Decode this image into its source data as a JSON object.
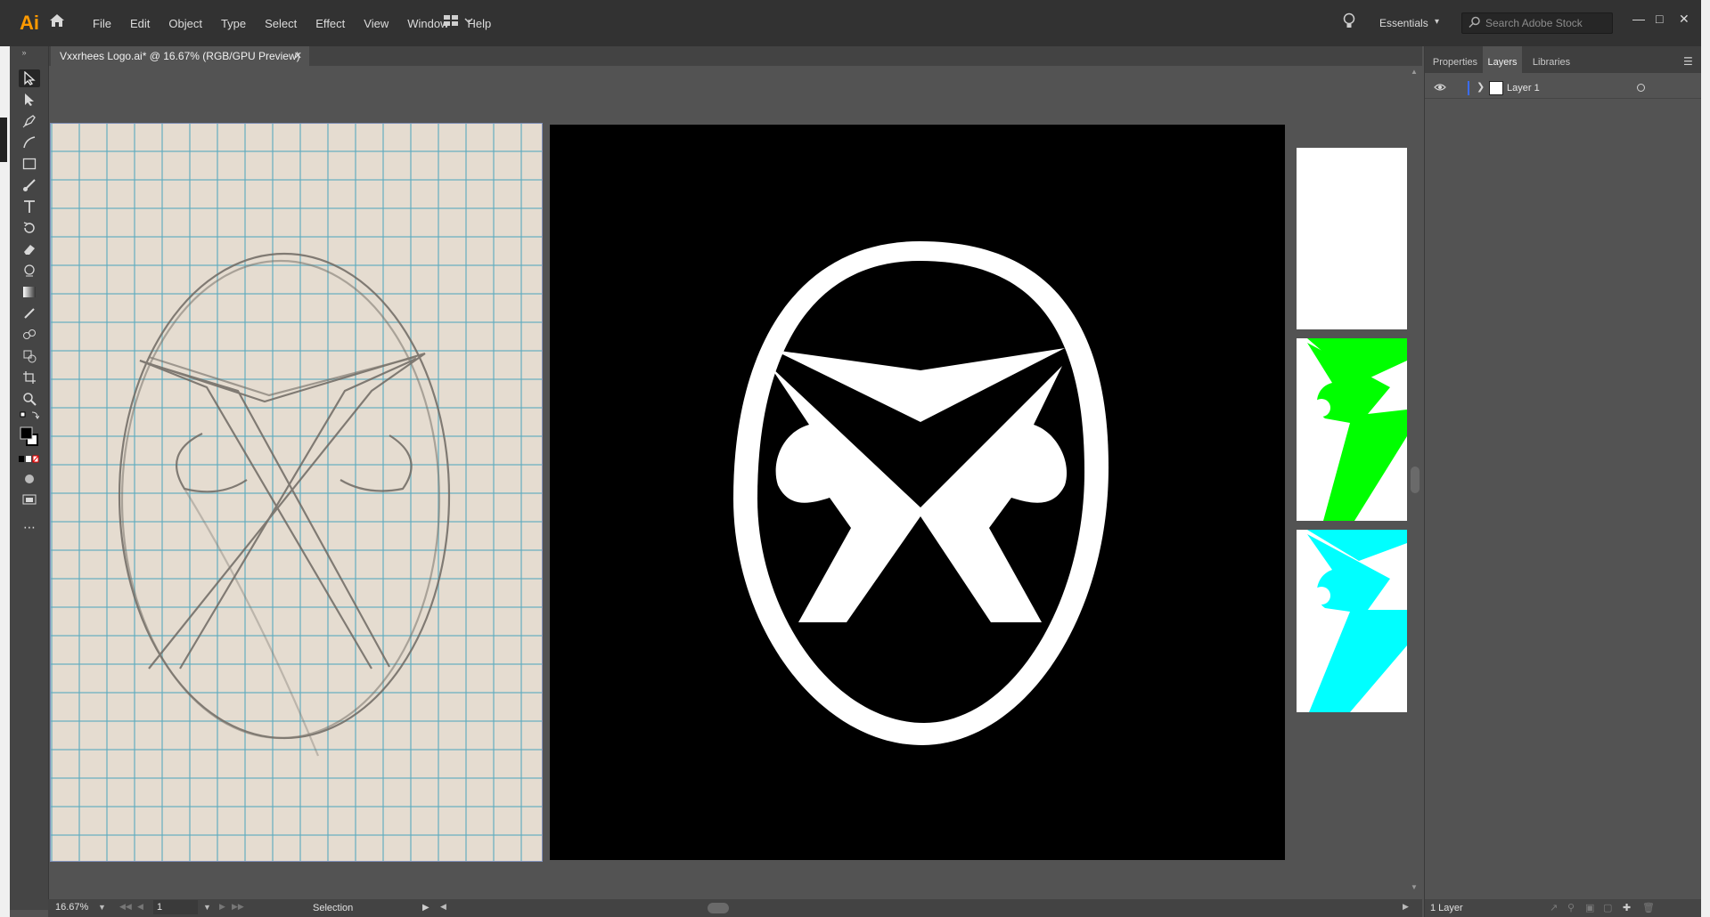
{
  "app": {
    "logo": "Ai"
  },
  "menu": [
    "File",
    "Edit",
    "Object",
    "Type",
    "Select",
    "Effect",
    "View",
    "Window",
    "Help"
  ],
  "workspace": {
    "label": "Essentials"
  },
  "search": {
    "placeholder": "Search Adobe Stock"
  },
  "document": {
    "tab_title": "Vxxrhees Logo.ai* @ 16.67% (RGB/GPU Preview)"
  },
  "panels": {
    "tabs": [
      "Properties",
      "Layers",
      "Libraries"
    ],
    "active_tab": "Layers",
    "layers": [
      {
        "name": "Layer 1",
        "visible": true
      }
    ],
    "layer_count": "1 Layer"
  },
  "status": {
    "zoom": "16.67%",
    "page": "1",
    "mode": "Selection"
  },
  "colors": {
    "accent": "#ff9a00",
    "thumb_green": "#00ff00",
    "thumb_cyan": "#00ffff",
    "layer_color": "#3a6cf7"
  }
}
